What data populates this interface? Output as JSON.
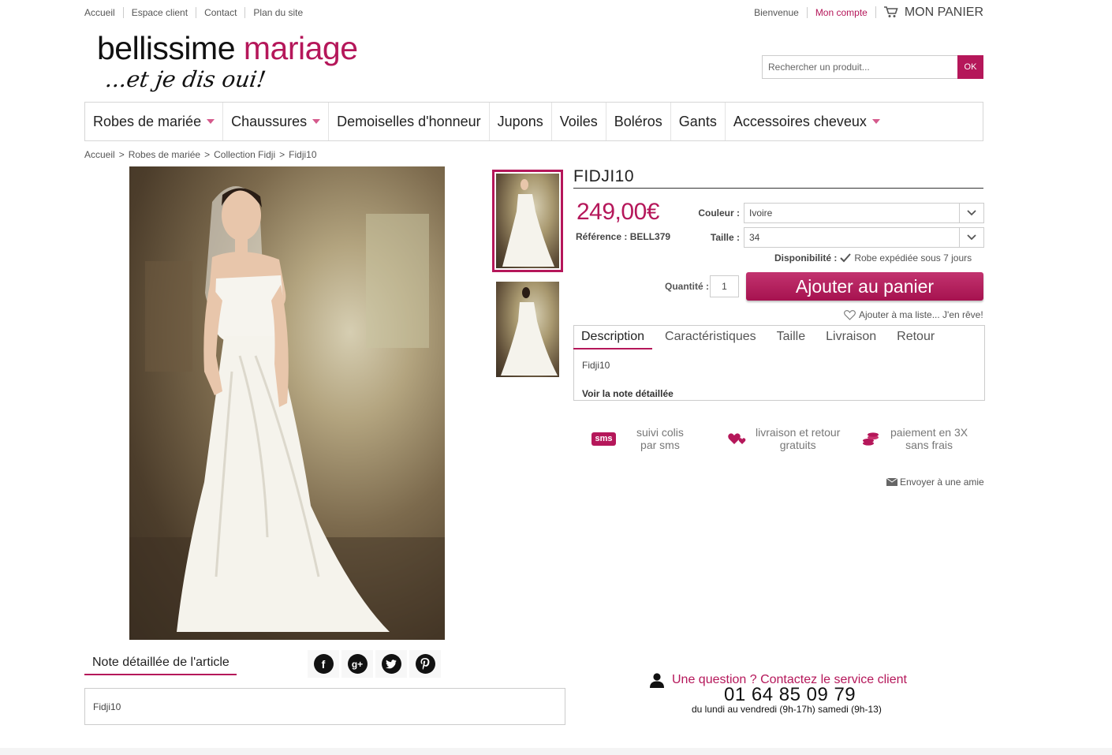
{
  "topbar": {
    "links": [
      "Accueil",
      "Espace client",
      "Contact",
      "Plan du site"
    ],
    "welcome": "Bienvenue",
    "account": "Mon compte",
    "cart": "MON PANIER"
  },
  "logo": {
    "part1": "bellissime",
    "part2": "mariage",
    "tagline": "...et je dis oui!"
  },
  "search": {
    "placeholder": "Rechercher un produit...",
    "button": "OK"
  },
  "nav": [
    {
      "label": "Robes de mariée",
      "dropdown": true
    },
    {
      "label": "Chaussures",
      "dropdown": true
    },
    {
      "label": "Demoiselles d'honneur",
      "dropdown": false
    },
    {
      "label": "Jupons",
      "dropdown": false
    },
    {
      "label": "Voiles",
      "dropdown": false
    },
    {
      "label": "Boléros",
      "dropdown": false
    },
    {
      "label": "Gants",
      "dropdown": false
    },
    {
      "label": "Accessoires cheveux",
      "dropdown": true
    }
  ],
  "breadcrumb": [
    "Accueil",
    ">",
    "Robes de mariée",
    ">",
    "Collection Fidji",
    ">",
    "Fidji10"
  ],
  "product": {
    "title": "FIDJI10",
    "price": "249,00€",
    "reference_label": "Référence :",
    "reference": "BELL379",
    "color_label": "Couleur :",
    "color_value": "Ivoire",
    "size_label": "Taille :",
    "size_value": "34",
    "availability_label": "Disponibilité :",
    "availability": "Robe expédiée sous 7 jours",
    "quantity_label": "Quantité :",
    "quantity": "1",
    "add_to_cart": "Ajouter au panier",
    "wishlist": "Ajouter à ma liste... J'en rêve!"
  },
  "tabs": {
    "items": [
      "Description",
      "Caractéristiques",
      "Taille",
      "Livraison",
      "Retour"
    ],
    "active": "Description",
    "content": "Fidji10",
    "link": "Voir la note détaillée"
  },
  "features": [
    {
      "icon": "sms",
      "line1": "suivi colis",
      "line2": "par sms"
    },
    {
      "line1": "livraison et retour",
      "line2": "gratuits"
    },
    {
      "line1": "paiement en 3X",
      "line2": "sans frais"
    }
  ],
  "send_friend": "Envoyer à une amie",
  "note": {
    "heading": "Note détaillée de l'article",
    "content": "Fidji10"
  },
  "social": [
    "f",
    "g+"
  ],
  "contact": {
    "question": "Une question ? Contactez le service client",
    "phone": "01 64 85 09 79",
    "hours": "du lundi au vendredi (9h-17h) samedi (9h-13)"
  },
  "colors": {
    "accent": "#b5175a"
  }
}
